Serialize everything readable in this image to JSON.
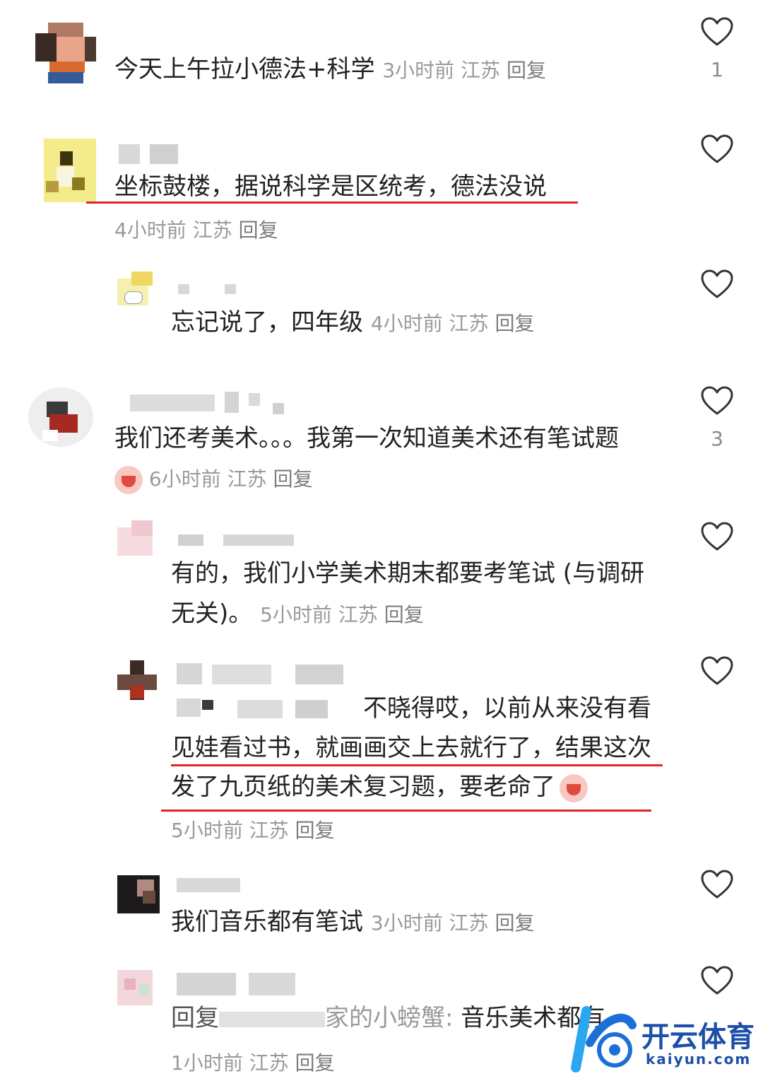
{
  "comments": [
    {
      "text": "今天上午拉小德法+科学",
      "time": "3小时前",
      "region": "江苏",
      "reply": "回复",
      "likes": "1"
    },
    {
      "text": "坐标鼓楼，据说科学是区统考，德法没说",
      "time": "4小时前",
      "region": "江苏",
      "reply": "回复",
      "likes": ""
    },
    {
      "text": "忘记说了，四年级",
      "time": "4小时前",
      "region": "江苏",
      "reply": "回复",
      "likes": ""
    },
    {
      "text": "我们还考美术。。。我第一次知道美术还有笔试题",
      "time": "6小时前",
      "region": "江苏",
      "reply": "回复",
      "likes": "3"
    },
    {
      "text_line1": "有的，我们小学美术期末都要考笔试 (与调研",
      "text_line2": "无关)。",
      "time": "5小时前",
      "region": "江苏",
      "reply": "回复",
      "likes": ""
    },
    {
      "text_line1": "不晓得哎，以前从来没有看",
      "text_line2": "见娃看过书，就画画交上去就行了，结果这次",
      "text_line3": "发了九页纸的美术复习题，要老命了",
      "time": "5小时前",
      "region": "江苏",
      "reply": "回复",
      "likes": ""
    },
    {
      "text": "我们音乐都有笔试",
      "time": "3小时前",
      "region": "江苏",
      "reply": "回复",
      "likes": ""
    },
    {
      "reply_prefix": "回复",
      "reply_target": "家的小螃蟹:",
      "text": "音乐美术都有",
      "time": "1小时前",
      "region": "江苏",
      "reply": "回复",
      "likes": ""
    }
  ],
  "icons": {
    "like": "heart-outline-icon",
    "emoji": "crying-emoji-icon"
  },
  "watermark": {
    "title": "开云体育",
    "url": "kaiyun.com"
  },
  "colors": {
    "underline": "#e0242a",
    "meta": "#9a9a9a",
    "text": "#222222"
  }
}
